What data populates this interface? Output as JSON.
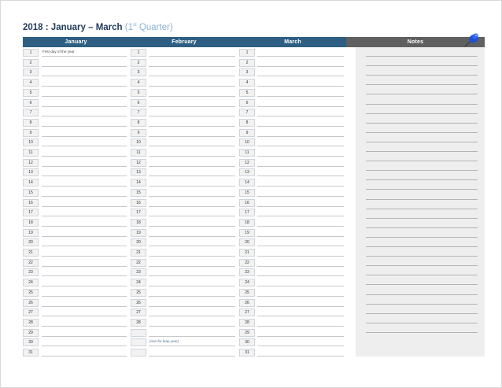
{
  "title": {
    "main": "2018 : January – March",
    "quarter_open": "(1",
    "quarter_sup": "st",
    "quarter_close": " Quarter)"
  },
  "headers": {
    "january": "January",
    "february": "February",
    "march": "March",
    "notes": "Notes"
  },
  "months": [
    {
      "key": "january",
      "days": 31,
      "notes": {
        "1": "First day of the year"
      }
    },
    {
      "key": "february",
      "days": 28,
      "extra_rows": 3,
      "notes": {
        "30": "(use for leap year)"
      }
    },
    {
      "key": "march",
      "days": 31,
      "notes": {}
    }
  ],
  "notes_line_count": 30,
  "colors": {
    "month_header": "#2e5f82",
    "notes_header": "#606060",
    "title": "#1f3a5a",
    "title_sub": "#8eb2d6",
    "pin": "#1f4fd8"
  },
  "icons": {
    "pin": "pushpin-icon"
  }
}
